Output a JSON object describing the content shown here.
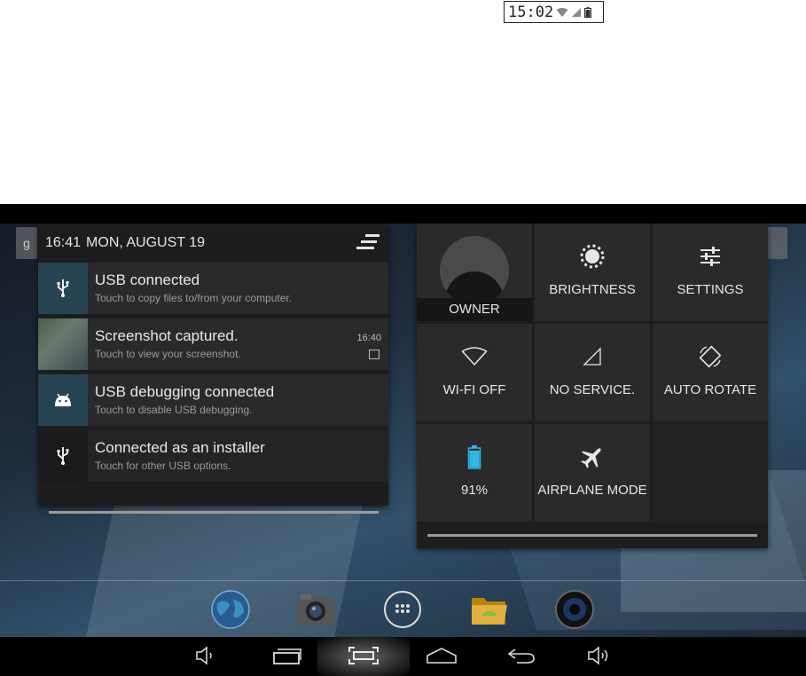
{
  "status_crop": {
    "time": "15:02"
  },
  "notification_panel": {
    "time": "16:41",
    "date": "MON, AUGUST 19",
    "items": [
      {
        "title": "USB connected",
        "subtitle": "Touch to copy files to/from your computer.",
        "icon": "usb-icon",
        "time": ""
      },
      {
        "title": "Screenshot captured.",
        "subtitle": "Touch to view your screenshot.",
        "icon": "screenshot-thumbnail",
        "time": "16:40"
      },
      {
        "title": "USB debugging connected",
        "subtitle": "Touch to disable USB debugging.",
        "icon": "android-icon",
        "time": ""
      },
      {
        "title": "Connected as an installer",
        "subtitle": "Touch for other USB options.",
        "icon": "usb-icon",
        "time": ""
      }
    ]
  },
  "quick_settings": {
    "tiles": [
      {
        "label": "OWNER",
        "icon": "avatar"
      },
      {
        "label": "BRIGHTNESS",
        "icon": "brightness-icon"
      },
      {
        "label": "SETTINGS",
        "icon": "settings-sliders-icon"
      },
      {
        "label": "WI-FI OFF",
        "icon": "wifi-icon"
      },
      {
        "label": "NO SERVICE.",
        "icon": "signal-icon"
      },
      {
        "label": "AUTO ROTATE",
        "icon": "rotate-icon"
      },
      {
        "label": "91%",
        "icon": "battery-icon"
      },
      {
        "label": "AIRPLANE MODE",
        "icon": "airplane-icon"
      }
    ],
    "battery_level": 0.91
  },
  "dock": {
    "apps": [
      "browser-globe",
      "camera",
      "app-drawer",
      "file-manager",
      "music"
    ]
  },
  "navbar": {
    "buttons": [
      "volume-down",
      "recent-apps",
      "screenshot",
      "home",
      "back",
      "volume-up"
    ]
  },
  "colors": {
    "tile_bg": "#2a2a2a",
    "panel_bg": "#1d1d1d",
    "battery_accent": "#33b5e5",
    "teal_icon_bg": "#274452"
  }
}
